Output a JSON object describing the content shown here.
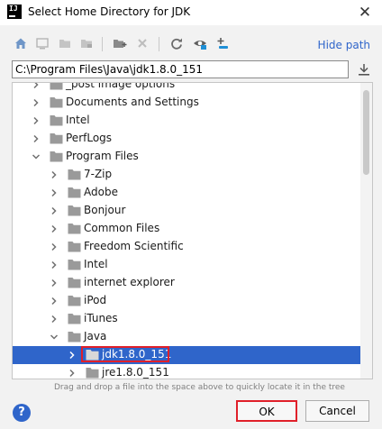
{
  "window": {
    "title": "Select Home Directory for JDK",
    "app_icon_text": "IJ"
  },
  "toolbar": {
    "icons": [
      "home-icon",
      "desktop-icon",
      "project-icon",
      "module-icon",
      "new-folder-icon",
      "delete-icon",
      "refresh-icon",
      "show-hidden-icon",
      "link-icon"
    ],
    "hide_path_label": "Hide path"
  },
  "path_input": {
    "value": "C:\\Program Files\\Java\\jdk1.8.0_151"
  },
  "tree": {
    "rows": [
      {
        "label": "_post image options",
        "expanded": false,
        "level": 1
      },
      {
        "label": "Documents and Settings",
        "expanded": false,
        "level": 1
      },
      {
        "label": "Intel",
        "expanded": false,
        "level": 1
      },
      {
        "label": "PerfLogs",
        "expanded": false,
        "level": 1
      },
      {
        "label": "Program Files",
        "expanded": true,
        "level": 1
      },
      {
        "label": "7-Zip",
        "expanded": false,
        "level": 2
      },
      {
        "label": "Adobe",
        "expanded": false,
        "level": 2
      },
      {
        "label": "Bonjour",
        "expanded": false,
        "level": 2
      },
      {
        "label": "Common Files",
        "expanded": false,
        "level": 2
      },
      {
        "label": "Freedom Scientific",
        "expanded": false,
        "level": 2
      },
      {
        "label": "Intel",
        "expanded": false,
        "level": 2
      },
      {
        "label": "internet explorer",
        "expanded": false,
        "level": 2
      },
      {
        "label": "iPod",
        "expanded": false,
        "level": 2
      },
      {
        "label": "iTunes",
        "expanded": false,
        "level": 2
      },
      {
        "label": "Java",
        "expanded": true,
        "level": 2
      },
      {
        "label": "jdk1.8.0_151",
        "expanded": false,
        "level": 3,
        "selected": true
      },
      {
        "label": "jre1.8.0_151",
        "expanded": false,
        "level": 3
      }
    ]
  },
  "hint_text": "Drag and drop a file into the space above to quickly locate it in the tree",
  "buttons": {
    "help": "?",
    "ok": "OK",
    "cancel": "Cancel"
  },
  "colors": {
    "selection": "#2f65ca",
    "highlight_border": "#e0202a",
    "link": "#2f65ca"
  }
}
